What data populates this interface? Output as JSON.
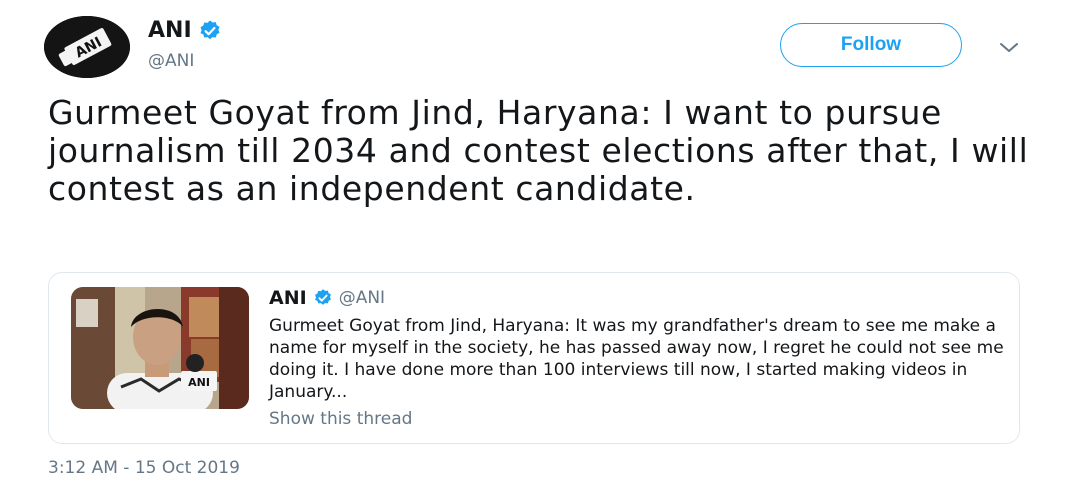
{
  "author": {
    "display_name": "ANI",
    "handle": "@ANI",
    "avatar_text": "ANI"
  },
  "follow_label": "Follow",
  "tweet": {
    "text": "Gurmeet Goyat from Jind, Haryana: I want to pursue journalism till 2034 and contest elections after that, I will contest as an independent candidate."
  },
  "quoted_tweet": {
    "display_name": "ANI",
    "handle": "@ANI",
    "text": "Gurmeet Goyat from Jind, Haryana: It was my grandfather's dream to see me make a name for myself in the society, he has passed away now, I regret he could not see me doing it. I have done more than 100 interviews till now, I started making videos in January...",
    "show_thread_label": "Show this thread",
    "mic_label": "ANI"
  },
  "timestamp": "3:12 AM - 15 Oct 2019",
  "colors": {
    "accent": "#1da1f2",
    "text_primary": "#14171a",
    "text_secondary": "#657786",
    "border": "#e1e8ed"
  }
}
